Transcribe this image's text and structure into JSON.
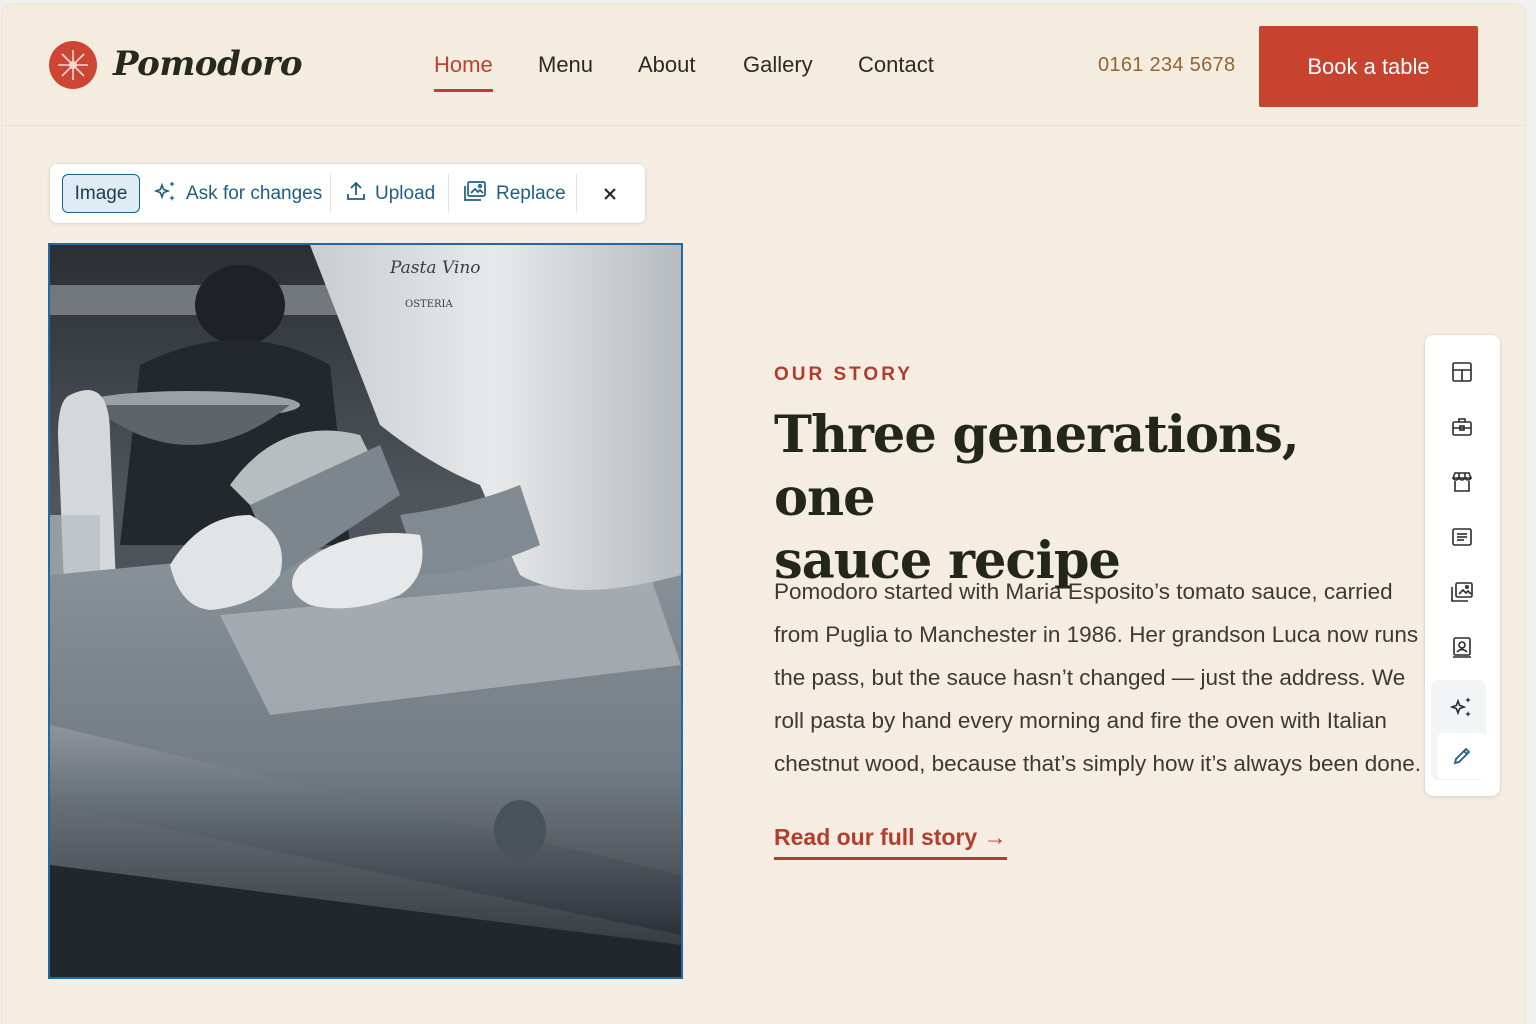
{
  "header": {
    "brand": "Pomodoro",
    "nav": [
      {
        "label": "Home",
        "active": true
      },
      {
        "label": "Menu",
        "active": false
      },
      {
        "label": "About",
        "active": false
      },
      {
        "label": "Gallery",
        "active": false
      },
      {
        "label": "Contact",
        "active": false
      }
    ],
    "phone": "0161 234 5678",
    "cta": "Book a table"
  },
  "image_toolbar": {
    "chip": "Image",
    "ask": "Ask for changes",
    "upload": "Upload",
    "replace": "Replace"
  },
  "photo": {
    "apron_text_1": "Pasta Vino",
    "apron_text_2": "OSTERIA"
  },
  "story": {
    "kicker": "OUR STORY",
    "headline_line1": "Three generations, one",
    "headline_line2": "sauce recipe",
    "body": "Pomodoro started with Maria Esposito’s tomato sauce, carried from Puglia to Manchester in 1986. Her grandson Luca now runs the pass, but the sauce hasn’t changed — just the address. We roll pasta by hand every morning and fire the oven with Italian chestnut wood, because that’s simply how it’s always been done.",
    "link": "Read our full story →"
  },
  "side_panel": {
    "icons": [
      "layout-icon",
      "briefcase-icon",
      "store-icon",
      "text-block-icon",
      "image-folder-icon",
      "contact-card-icon",
      "sparkle-icon",
      "pencil-icon"
    ]
  },
  "colors": {
    "background": "#f5ede2",
    "accent": "#c8432f",
    "heading": "#22261b",
    "toolbar_blue": "#1e5e86",
    "phone": "#946433"
  }
}
